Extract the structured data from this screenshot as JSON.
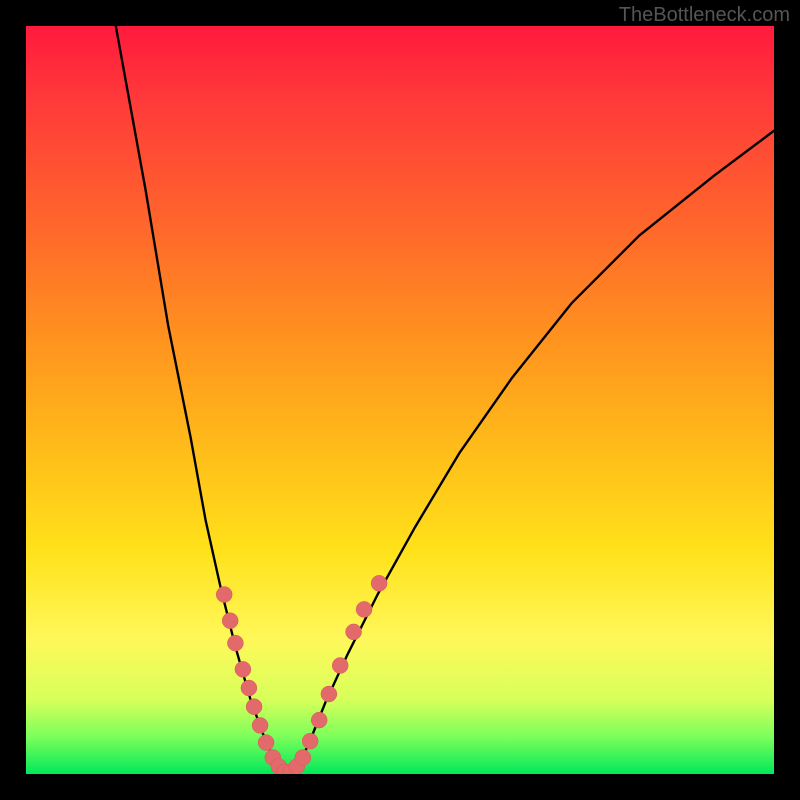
{
  "watermark": "TheBottleneck.com",
  "chart_data": {
    "type": "line",
    "title": "",
    "xlabel": "",
    "ylabel": "",
    "series": [
      {
        "name": "curve",
        "points": [
          [
            0.12,
            1.0
          ],
          [
            0.16,
            0.78
          ],
          [
            0.19,
            0.6
          ],
          [
            0.22,
            0.45
          ],
          [
            0.24,
            0.34
          ],
          [
            0.26,
            0.25
          ],
          [
            0.28,
            0.17
          ],
          [
            0.3,
            0.1
          ],
          [
            0.32,
            0.045
          ],
          [
            0.335,
            0.012
          ],
          [
            0.345,
            0.003
          ],
          [
            0.355,
            0.003
          ],
          [
            0.365,
            0.012
          ],
          [
            0.38,
            0.045
          ],
          [
            0.4,
            0.095
          ],
          [
            0.43,
            0.16
          ],
          [
            0.47,
            0.24
          ],
          [
            0.52,
            0.33
          ],
          [
            0.58,
            0.43
          ],
          [
            0.65,
            0.53
          ],
          [
            0.73,
            0.63
          ],
          [
            0.82,
            0.72
          ],
          [
            0.92,
            0.8
          ],
          [
            1.0,
            0.86
          ]
        ]
      }
    ],
    "markers": [
      [
        0.265,
        0.24
      ],
      [
        0.273,
        0.205
      ],
      [
        0.28,
        0.175
      ],
      [
        0.29,
        0.14
      ],
      [
        0.298,
        0.115
      ],
      [
        0.305,
        0.09
      ],
      [
        0.313,
        0.065
      ],
      [
        0.321,
        0.042
      ],
      [
        0.33,
        0.022
      ],
      [
        0.338,
        0.01
      ],
      [
        0.346,
        0.003
      ],
      [
        0.354,
        0.003
      ],
      [
        0.362,
        0.01
      ],
      [
        0.37,
        0.022
      ],
      [
        0.38,
        0.044
      ],
      [
        0.392,
        0.072
      ],
      [
        0.405,
        0.107
      ],
      [
        0.42,
        0.145
      ],
      [
        0.438,
        0.19
      ],
      [
        0.452,
        0.22
      ],
      [
        0.472,
        0.255
      ]
    ],
    "xlim": [
      0,
      1
    ],
    "ylim": [
      0,
      1
    ]
  }
}
